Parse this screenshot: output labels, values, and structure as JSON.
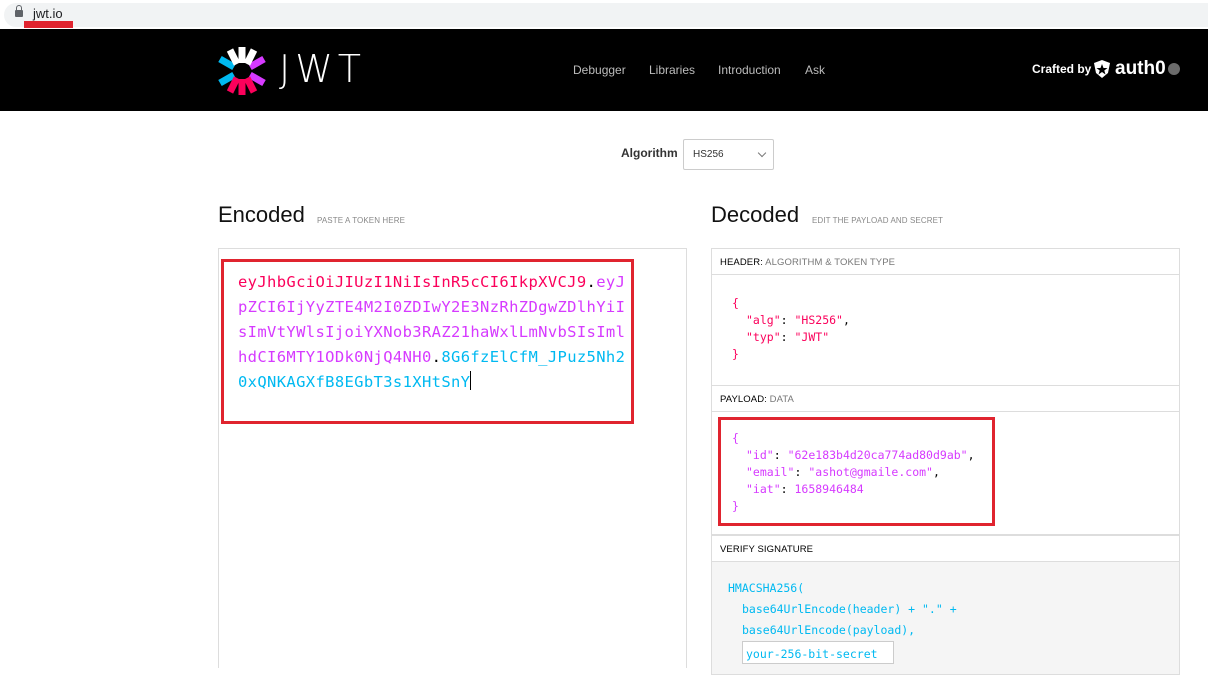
{
  "browser": {
    "url": "jwt.io"
  },
  "nav": {
    "logo_text": "JWT",
    "links": [
      "Debugger",
      "Libraries",
      "Introduction",
      "Ask"
    ],
    "crafted_by": "Crafted by",
    "brand": "auth0"
  },
  "algorithm": {
    "label": "Algorithm",
    "value": "HS256"
  },
  "encoded": {
    "title": "Encoded",
    "subtitle": "PASTE A TOKEN HERE",
    "header_part": "eyJhbGciOiJIUzI1NiIsInR5cCI6IkpXVCJ9",
    "payload_part": "eyJpZCI6IjYyZTE4M2I0ZDIwY2E3NzRhZDgwZDlhYiIsImVtYWlsIjoiYXNob3RAZ21haWxlLmNvbSIsImlhdCI6MTY1ODk0NjQ4NH0",
    "signature_part": "8G6fzElCfM_JPuz5Nh20xQNKAGXfB8EGbT3s1XHtSnY"
  },
  "decoded": {
    "title": "Decoded",
    "subtitle": "EDIT THE PAYLOAD AND SECRET",
    "header_label": "HEADER:",
    "header_sublabel": "ALGORITHM & TOKEN TYPE",
    "header_json": {
      "alg": "HS256",
      "typ": "JWT"
    },
    "payload_label": "PAYLOAD:",
    "payload_sublabel": "DATA",
    "payload_json": {
      "id": "62e183b4d20ca774ad80d9ab",
      "email": "ashot@gmaile.com",
      "iat": "1658946484"
    },
    "verify_label": "VERIFY SIGNATURE",
    "sig_fn": "HMACSHA256(",
    "sig_line1": "base64UrlEncode(header) + \".\" +",
    "sig_line2": "base64UrlEncode(payload),",
    "secret_value": "your-256-bit-secret"
  },
  "colors": {
    "header_part": "#fb015b",
    "payload_part": "#d63aff",
    "signature_part": "#00b9f1",
    "highlight_box": "#e0242f"
  }
}
